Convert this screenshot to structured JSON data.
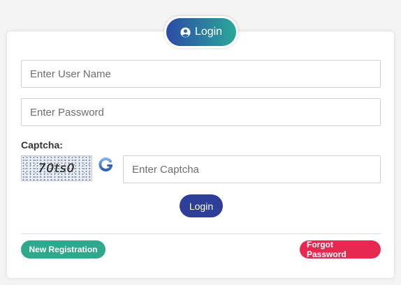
{
  "header": {
    "login_label": "Login",
    "icon": "user-circle-icon"
  },
  "form": {
    "username_placeholder": "Enter User Name",
    "password_placeholder": "Enter Password",
    "captcha_label": "Captcha:",
    "captcha_text": "70ts0",
    "captcha_refresh_icon": "refresh-icon",
    "captcha_placeholder": "Enter Captcha",
    "submit_label": "Login"
  },
  "footer": {
    "new_registration_label": "New Registration",
    "forgot_password_label": "Forgot Password"
  },
  "colors": {
    "pill_gradient_start": "#2c4aa6",
    "pill_gradient_end": "#2aa89a",
    "submit_button": "#2e3f9a",
    "new_registration": "#2ea98c",
    "forgot_password": "#e8294f"
  }
}
